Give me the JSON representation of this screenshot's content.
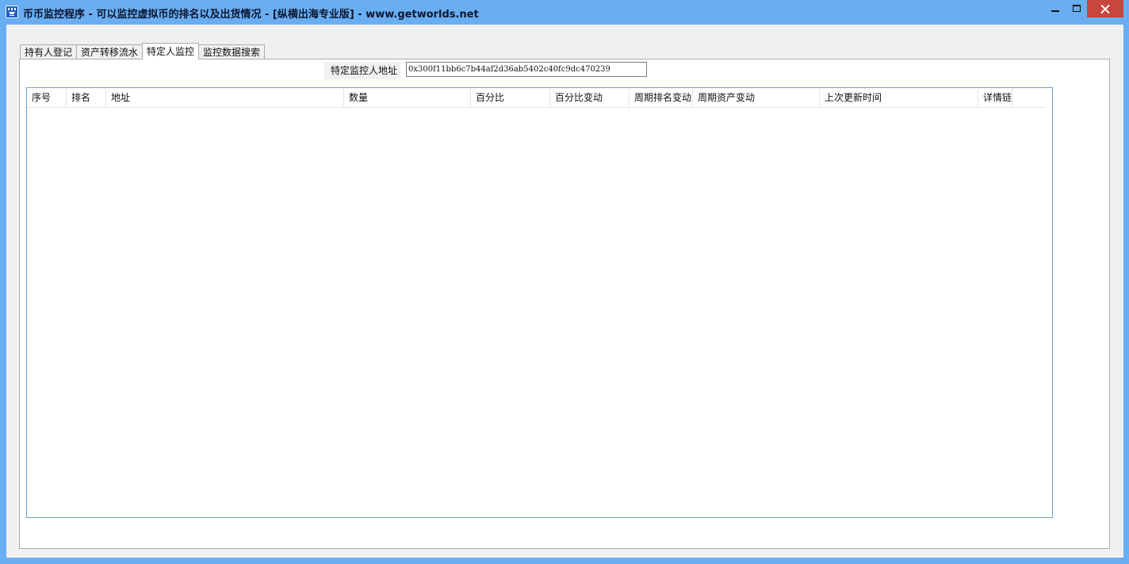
{
  "window": {
    "title": "币币监控程序 -   可以监控虚拟币的排名以及出货情况 -   [纵横出海专业版] - www.getworlds.net",
    "icon": "app-logo-icon",
    "controls": {
      "minimize": "minimize-icon",
      "maximize": "maximize-icon",
      "close": "close-icon"
    },
    "close_color": "#c7463d",
    "frame_color": "#6aaef2"
  },
  "tabs": [
    {
      "label": "持有人登记",
      "active": false
    },
    {
      "label": "资产转移流水",
      "active": false
    },
    {
      "label": "特定人监控",
      "active": true
    },
    {
      "label": "监控数据搜索",
      "active": false
    }
  ],
  "monitor": {
    "address_label": "特定监控人地址",
    "address_value": "0x300f11bb6c7b44af2d36ab5402c40fc9dc470239"
  },
  "table": {
    "columns": [
      "序号",
      "排名",
      "地址",
      "数量",
      "百分比",
      "百分比变动",
      "周期排名变动",
      "周期资产变动",
      "上次更新时间",
      "详情链接"
    ],
    "rows": []
  }
}
